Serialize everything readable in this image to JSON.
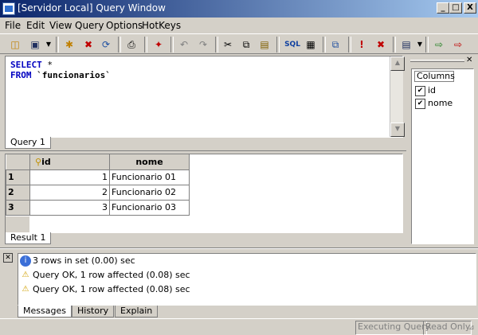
{
  "window": {
    "title": "[Servidor Local] Query Window",
    "controls": [
      "_",
      "□",
      "X"
    ]
  },
  "menu": [
    "File",
    "Edit",
    "View",
    "Query",
    "Options",
    "HotKeys"
  ],
  "editor": {
    "keyword_select": "SELECT",
    "select_rest": " *",
    "keyword_from": "FROM",
    "table": " `funcionarios`",
    "tab": "Query 1"
  },
  "results": {
    "columns": [
      "id",
      "nome"
    ],
    "rows": [
      {
        "num": "1",
        "id": "1",
        "nome": "Funcionario 01"
      },
      {
        "num": "2",
        "id": "2",
        "nome": "Funcionario 02"
      },
      {
        "num": "3",
        "id": "3",
        "nome": "Funcionario 03"
      }
    ],
    "tab": "Result 1"
  },
  "columns_panel": {
    "title": "Columns",
    "items": [
      {
        "label": "id",
        "checked": true
      },
      {
        "label": "nome",
        "checked": true
      }
    ]
  },
  "messages": {
    "lines": [
      {
        "icon": "info-icon",
        "text": "3 rows in set (0.00) sec"
      },
      {
        "icon": "warning-icon",
        "text": "Query OK, 1 row affected (0.08) sec"
      },
      {
        "icon": "warning-icon",
        "text": "Query OK, 1 row affected (0.08) sec"
      }
    ],
    "tabs": [
      "Messages",
      "History",
      "Explain"
    ]
  },
  "status": {
    "executing": "Executing Query",
    "readonly": "Read Only"
  },
  "colors": {
    "titlebar_start": "#0a246a",
    "titlebar_end": "#a6caf0",
    "keyword": "#0000c0",
    "face": "#d4d0c8"
  }
}
